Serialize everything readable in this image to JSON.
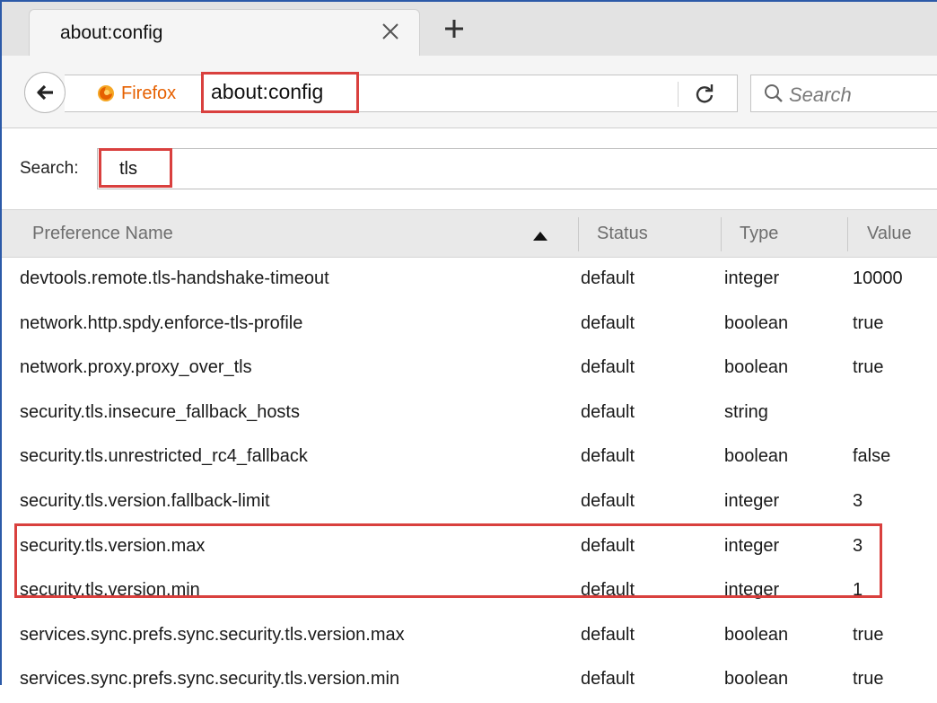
{
  "tab": {
    "title": "about:config"
  },
  "navbar": {
    "identity_label": "Firefox",
    "url": "about:config",
    "search_placeholder": "Search"
  },
  "filter": {
    "label": "Search:",
    "value": "tls"
  },
  "table": {
    "columns": {
      "name": "Preference Name",
      "status": "Status",
      "type": "Type",
      "value": "Value"
    },
    "rows": [
      {
        "name": "devtools.remote.tls-handshake-timeout",
        "status": "default",
        "type": "integer",
        "value": "10000"
      },
      {
        "name": "network.http.spdy.enforce-tls-profile",
        "status": "default",
        "type": "boolean",
        "value": "true"
      },
      {
        "name": "network.proxy.proxy_over_tls",
        "status": "default",
        "type": "boolean",
        "value": "true"
      },
      {
        "name": "security.tls.insecure_fallback_hosts",
        "status": "default",
        "type": "string",
        "value": ""
      },
      {
        "name": "security.tls.unrestricted_rc4_fallback",
        "status": "default",
        "type": "boolean",
        "value": "false"
      },
      {
        "name": "security.tls.version.fallback-limit",
        "status": "default",
        "type": "integer",
        "value": "3"
      },
      {
        "name": "security.tls.version.max",
        "status": "default",
        "type": "integer",
        "value": "3"
      },
      {
        "name": "security.tls.version.min",
        "status": "default",
        "type": "integer",
        "value": "1"
      },
      {
        "name": "services.sync.prefs.sync.security.tls.version.max",
        "status": "default",
        "type": "boolean",
        "value": "true"
      },
      {
        "name": "services.sync.prefs.sync.security.tls.version.min",
        "status": "default",
        "type": "boolean",
        "value": "true"
      }
    ]
  },
  "colors": {
    "highlight": "#d9403e",
    "firefox_orange": "#e66000",
    "window_frame": "#2c5aa8"
  }
}
